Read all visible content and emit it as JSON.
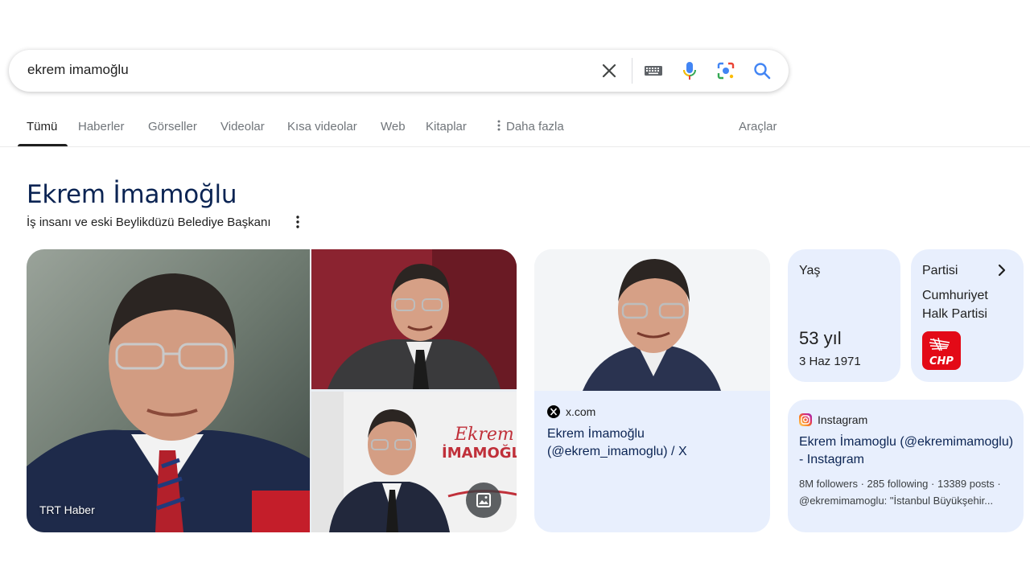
{
  "search": {
    "query": "ekrem imamoğlu",
    "icons": [
      "close-icon",
      "keyboard-icon",
      "mic-icon",
      "lens-icon",
      "search-icon"
    ]
  },
  "tabs": {
    "items": [
      {
        "label": "Tümü",
        "active": true
      },
      {
        "label": "Haberler"
      },
      {
        "label": "Görseller"
      },
      {
        "label": "Videolar"
      },
      {
        "label": "Kısa videolar"
      },
      {
        "label": "Web"
      },
      {
        "label": "Kitaplar"
      },
      {
        "label": "Daha fazla"
      }
    ],
    "tools_label": "Araçlar"
  },
  "entity": {
    "title": "Ekrem İmamoğlu",
    "subtitle": "İş insanı ve eski Beylikdüzü Belediye Başkanı"
  },
  "images": {
    "main_credit": "TRT Haber",
    "poster_text_1": "Ekrem",
    "poster_text_2": "İMAMOĞLU"
  },
  "x_card": {
    "source": "x.com",
    "title": "Ekrem İmamoğlu (@ekrem_imamoglu) / X"
  },
  "age_card": {
    "label": "Yaş",
    "value": "53 yıl",
    "date": "3 Haz 1971"
  },
  "party_card": {
    "label": "Partisi",
    "value": "Cumhuriyet Halk Partisi",
    "logo_text": "CHP"
  },
  "instagram_card": {
    "source": "Instagram",
    "title": "Ekrem İmamoglu (@ekremimamoglu) - Instagram",
    "stats": "8M followers · 285 following · 13389 posts ·",
    "bio": "@ekremimamoglu: \"İstanbul Büyükşehir..."
  },
  "colors": {
    "title_blue": "#0b2453",
    "card_bg": "#e8effd",
    "search_blue": "#4285f4",
    "chp_red": "#e30a17"
  }
}
